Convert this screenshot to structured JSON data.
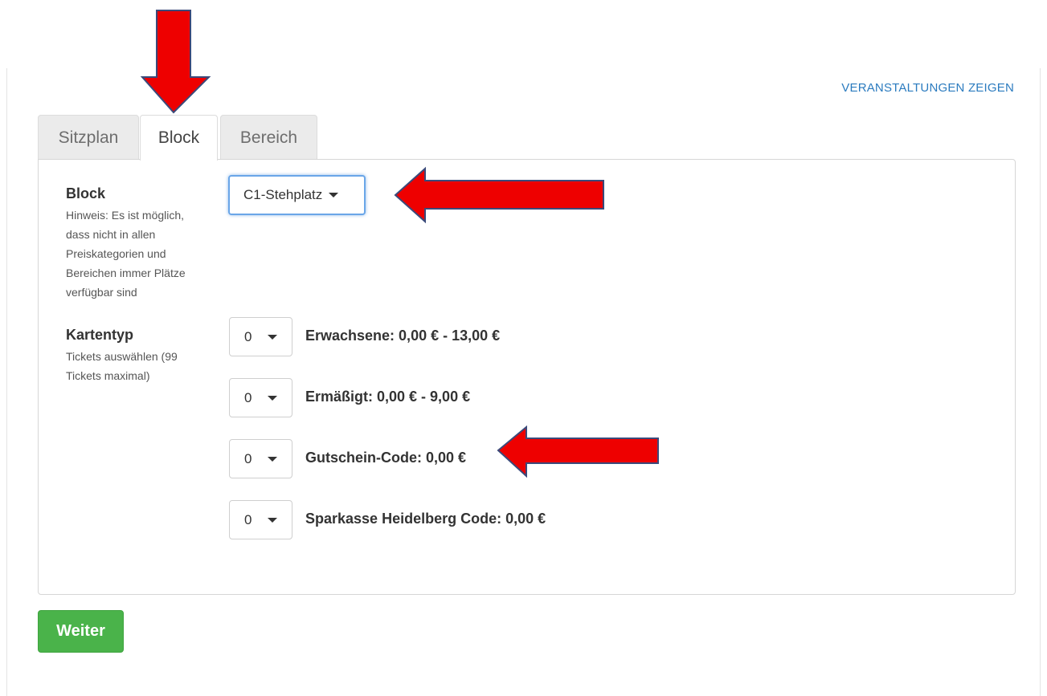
{
  "header": {
    "link_label": "VERANSTALTUNGEN ZEIGEN"
  },
  "tabs": [
    {
      "label": "Sitzplan",
      "active": false
    },
    {
      "label": "Block",
      "active": true
    },
    {
      "label": "Bereich",
      "active": false
    }
  ],
  "block_section": {
    "title": "Block",
    "hint": "Hinweis: Es ist möglich, dass nicht in allen Preiskategorien und Bereichen immer Plätze verfügbar sind",
    "selected_block": "C1-Stehplatz"
  },
  "ticket_section": {
    "title": "Kartentyp",
    "hint": "Tickets auswählen (99 Tickets maximal)",
    "tickets": [
      {
        "quantity": "0",
        "label": "Erwachsene: 0,00 € - 13,00 €"
      },
      {
        "quantity": "0",
        "label": "Ermäßigt: 0,00 € - 9,00 €"
      },
      {
        "quantity": "0",
        "label": "Gutschein-Code: 0,00 €"
      },
      {
        "quantity": "0",
        "label": "Sparkasse Heidelberg Code: 0,00 €"
      }
    ]
  },
  "actions": {
    "continue_label": "Weiter"
  },
  "colors": {
    "link": "#2b7bbf",
    "continue_button": "#4ab34a",
    "annotation_arrow": "#ee0000",
    "focus_border": "#6aa6e8"
  },
  "annotations": [
    {
      "icon": "red-arrow-down",
      "points_to": "tab-block"
    },
    {
      "icon": "red-arrow-left",
      "points_to": "block-select"
    },
    {
      "icon": "red-arrow-left",
      "points_to": "ticket-gutschein"
    }
  ]
}
